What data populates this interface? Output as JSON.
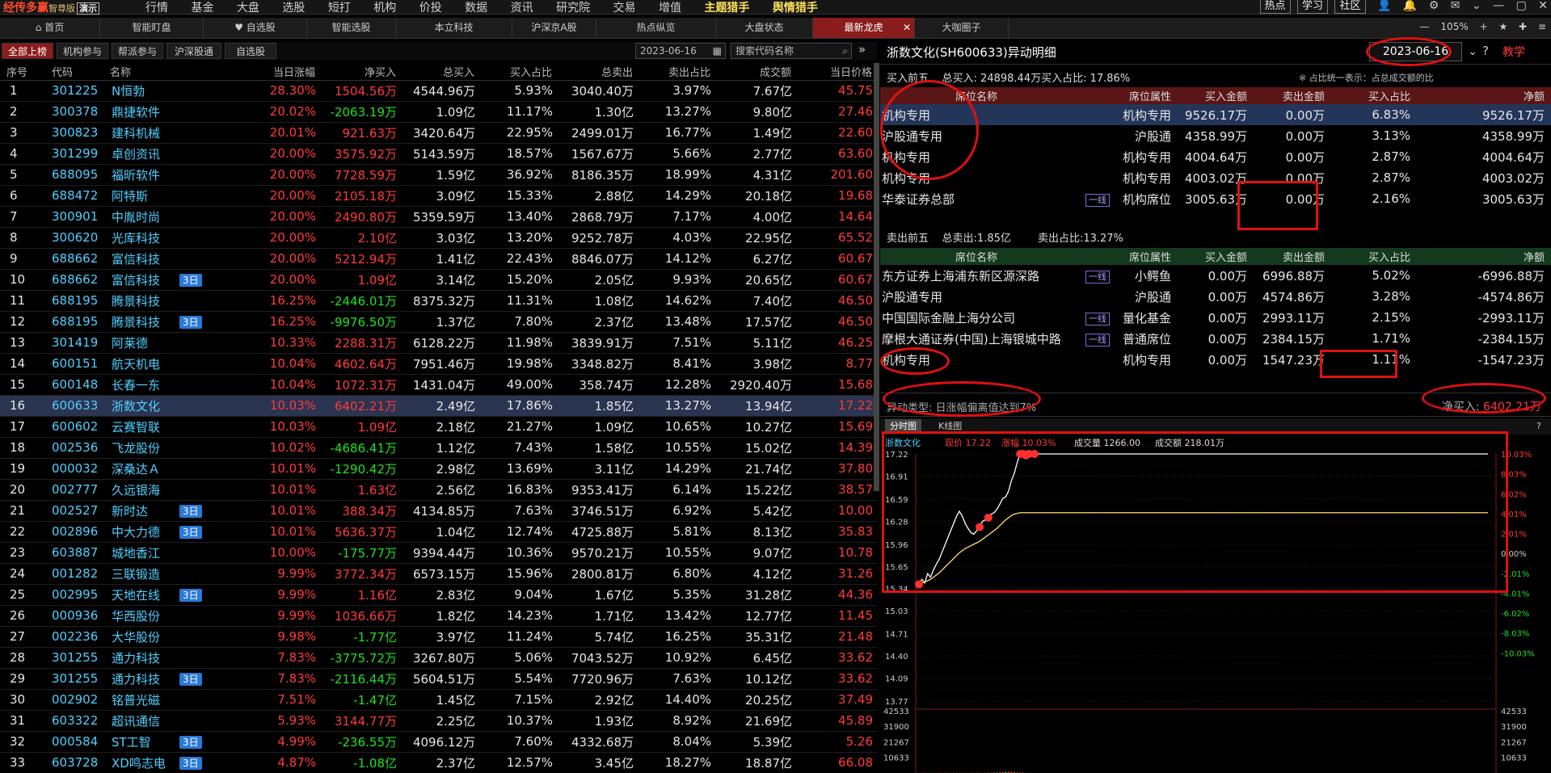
{
  "topbar": {
    "logo": "经传多赢",
    "edition": "智尊版",
    "demo": "演示",
    "menu": [
      "行情",
      "基金",
      "大盘",
      "选股",
      "短打",
      "机构",
      "价投",
      "数据",
      "资讯",
      "研究院",
      "交易",
      "增值",
      "主题猎手",
      "舆情猎手"
    ],
    "buttons": [
      "热点",
      "学习",
      "社区"
    ]
  },
  "tabs": [
    "首页",
    "智能盯盘",
    "自选股",
    "智能选股",
    "本立科技",
    "沪深京A股",
    "热点纵览",
    "大盘状态",
    "最新龙虎",
    "大咖圈子"
  ],
  "tab_right": {
    "zoom": "105%"
  },
  "filters": [
    "全部上榜",
    "机构参与",
    "帮派参与",
    "沪深股通",
    "自选股"
  ],
  "filter_date": "2023-06-16",
  "search_placeholder": "搜索代码名称",
  "list": {
    "headers": [
      "序号",
      "代码",
      "名称",
      "",
      "当日涨幅",
      "净买入",
      "总买入",
      "买入占比",
      "总卖出",
      "卖出占比",
      "成交额",
      "当日价格"
    ],
    "rows": [
      [
        "1",
        "301225",
        "N恒勃",
        "",
        "28.30%",
        "1504.56万",
        "4544.96万",
        "5.93%",
        "3040.40万",
        "3.97%",
        "7.67亿",
        "45.75"
      ],
      [
        "2",
        "300378",
        "鼎捷软件",
        "",
        "20.02%",
        "-2063.19万",
        "1.09亿",
        "11.17%",
        "1.30亿",
        "13.27%",
        "9.80亿",
        "27.46"
      ],
      [
        "3",
        "300823",
        "建科机械",
        "",
        "20.01%",
        "921.63万",
        "3420.64万",
        "22.95%",
        "2499.01万",
        "16.77%",
        "1.49亿",
        "22.60"
      ],
      [
        "4",
        "301299",
        "卓创资讯",
        "",
        "20.00%",
        "3575.92万",
        "5143.59万",
        "18.57%",
        "1567.67万",
        "5.66%",
        "2.77亿",
        "63.60"
      ],
      [
        "5",
        "688095",
        "福昕软件",
        "",
        "20.00%",
        "7728.59万",
        "1.59亿",
        "36.92%",
        "8186.35万",
        "18.99%",
        "4.31亿",
        "201.60"
      ],
      [
        "6",
        "688472",
        "阿特斯",
        "",
        "20.00%",
        "2105.18万",
        "3.09亿",
        "15.33%",
        "2.88亿",
        "14.29%",
        "20.18亿",
        "19.68"
      ],
      [
        "7",
        "300901",
        "中胤时尚",
        "",
        "20.00%",
        "2490.80万",
        "5359.59万",
        "13.40%",
        "2868.79万",
        "7.17%",
        "4.00亿",
        "14.64"
      ],
      [
        "8",
        "300620",
        "光库科技",
        "",
        "20.00%",
        "2.10亿",
        "3.03亿",
        "13.20%",
        "9252.78万",
        "4.03%",
        "22.95亿",
        "65.52"
      ],
      [
        "9",
        "688662",
        "富信科技",
        "",
        "20.00%",
        "5212.94万",
        "1.41亿",
        "22.43%",
        "8846.07万",
        "14.12%",
        "6.27亿",
        "60.67"
      ],
      [
        "10",
        "688662",
        "富信科技",
        "3日",
        "20.00%",
        "1.09亿",
        "3.14亿",
        "15.20%",
        "2.05亿",
        "9.93%",
        "20.65亿",
        "60.67"
      ],
      [
        "11",
        "688195",
        "腾景科技",
        "",
        "16.25%",
        "-2446.01万",
        "8375.32万",
        "11.31%",
        "1.08亿",
        "14.62%",
        "7.40亿",
        "46.50"
      ],
      [
        "12",
        "688195",
        "腾景科技",
        "3日",
        "16.25%",
        "-9976.50万",
        "1.37亿",
        "7.80%",
        "2.37亿",
        "13.48%",
        "17.57亿",
        "46.50"
      ],
      [
        "13",
        "301419",
        "阿莱德",
        "",
        "10.33%",
        "2288.31万",
        "6128.22万",
        "11.98%",
        "3839.91万",
        "7.51%",
        "5.11亿",
        "46.25"
      ],
      [
        "14",
        "600151",
        "航天机电",
        "",
        "10.04%",
        "4602.64万",
        "7951.46万",
        "19.98%",
        "3348.82万",
        "8.41%",
        "3.98亿",
        "8.77"
      ],
      [
        "15",
        "600148",
        "长春一东",
        "",
        "10.04%",
        "1072.31万",
        "1431.04万",
        "49.00%",
        "358.74万",
        "12.28%",
        "2920.40万",
        "15.68"
      ],
      [
        "16",
        "600633",
        "浙数文化",
        "",
        "10.03%",
        "6402.21万",
        "2.49亿",
        "17.86%",
        "1.85亿",
        "13.27%",
        "13.94亿",
        "17.22"
      ],
      [
        "17",
        "600602",
        "云赛智联",
        "",
        "10.03%",
        "1.09亿",
        "2.18亿",
        "21.27%",
        "1.09亿",
        "10.65%",
        "10.27亿",
        "15.69"
      ],
      [
        "18",
        "002536",
        "飞龙股份",
        "",
        "10.02%",
        "-4686.41万",
        "1.12亿",
        "7.43%",
        "1.58亿",
        "10.55%",
        "15.02亿",
        "14.39"
      ],
      [
        "19",
        "000032",
        "深桑达Ａ",
        "",
        "10.01%",
        "-1290.42万",
        "2.98亿",
        "13.69%",
        "3.11亿",
        "14.29%",
        "21.74亿",
        "37.80"
      ],
      [
        "20",
        "002777",
        "久远银海",
        "",
        "10.01%",
        "1.63亿",
        "2.56亿",
        "16.83%",
        "9353.41万",
        "6.14%",
        "15.22亿",
        "38.57"
      ],
      [
        "21",
        "002527",
        "新时达",
        "3日",
        "10.01%",
        "388.34万",
        "4134.85万",
        "7.63%",
        "3746.51万",
        "6.92%",
        "5.42亿",
        "10.00"
      ],
      [
        "22",
        "002896",
        "中大力德",
        "3日",
        "10.01%",
        "5636.37万",
        "1.04亿",
        "12.74%",
        "4725.88万",
        "5.81%",
        "8.13亿",
        "35.83"
      ],
      [
        "23",
        "603887",
        "城地香江",
        "",
        "10.00%",
        "-175.77万",
        "9394.44万",
        "10.36%",
        "9570.21万",
        "10.55%",
        "9.07亿",
        "10.78"
      ],
      [
        "24",
        "001282",
        "三联锻造",
        "",
        "9.99%",
        "3772.34万",
        "6573.15万",
        "15.96%",
        "2800.81万",
        "6.80%",
        "4.12亿",
        "31.26"
      ],
      [
        "25",
        "002995",
        "天地在线",
        "3日",
        "9.99%",
        "1.16亿",
        "2.83亿",
        "9.04%",
        "1.67亿",
        "5.35%",
        "31.28亿",
        "44.36"
      ],
      [
        "26",
        "000936",
        "华西股份",
        "",
        "9.99%",
        "1036.66万",
        "1.82亿",
        "14.23%",
        "1.71亿",
        "13.42%",
        "12.77亿",
        "11.45"
      ],
      [
        "27",
        "002236",
        "大华股份",
        "",
        "9.98%",
        "-1.77亿",
        "3.97亿",
        "11.24%",
        "5.74亿",
        "16.25%",
        "35.31亿",
        "21.48"
      ],
      [
        "28",
        "301255",
        "通力科技",
        "",
        "7.83%",
        "-3775.72万",
        "3267.80万",
        "5.06%",
        "7043.52万",
        "10.92%",
        "6.45亿",
        "33.62"
      ],
      [
        "29",
        "301255",
        "通力科技",
        "3日",
        "7.83%",
        "-2116.44万",
        "5604.51万",
        "5.54%",
        "7720.96万",
        "7.63%",
        "10.12亿",
        "33.62"
      ],
      [
        "30",
        "002902",
        "铭普光磁",
        "",
        "7.51%",
        "-1.47亿",
        "1.45亿",
        "7.15%",
        "2.92亿",
        "14.40%",
        "20.25亿",
        "37.49"
      ],
      [
        "31",
        "603322",
        "超讯通信",
        "",
        "5.93%",
        "3144.77万",
        "2.25亿",
        "10.37%",
        "1.93亿",
        "8.92%",
        "21.69亿",
        "45.89"
      ],
      [
        "32",
        "000584",
        "ST工智",
        "3日",
        "4.99%",
        "-236.55万",
        "4096.12万",
        "7.60%",
        "4332.68万",
        "8.04%",
        "5.39亿",
        "5.26"
      ],
      [
        "33",
        "603728",
        "XD鸣志电",
        "3日",
        "4.87%",
        "-1.08亿",
        "2.37亿",
        "12.57%",
        "3.45亿",
        "18.27%",
        "18.87亿",
        "66.08"
      ]
    ]
  },
  "detail": {
    "title": "浙数文化(SH600633)异动明细",
    "date": "2023-06-16",
    "teach": "教学",
    "buy_summary": {
      "label": "买入前五",
      "total": "总买入: 24898.44万",
      "ratio": "买入占比: 17.86%",
      "note": "※ 占比统一表示：占总成交额的比"
    },
    "sell_summary": {
      "label": "卖出前五",
      "total": "总卖出:1.85亿",
      "ratio": "卖出占比:13.27%"
    },
    "headers": [
      "席位名称",
      "",
      "席位属性",
      "买入金额",
      "卖出金额",
      "买入占比",
      "净额"
    ],
    "yx": "一线",
    "buy_rows": [
      [
        "机构专用",
        "",
        "机构专用",
        "9526.17万",
        "0.00万",
        "6.83%",
        "9526.17万"
      ],
      [
        "沪股通专用",
        "",
        "沪股通",
        "4358.99万",
        "0.00万",
        "3.13%",
        "4358.99万"
      ],
      [
        "机构专用",
        "",
        "机构专用",
        "4004.64万",
        "0.00万",
        "2.87%",
        "4004.64万"
      ],
      [
        "机构专用",
        "",
        "机构专用",
        "4003.02万",
        "0.00万",
        "2.87%",
        "4003.02万"
      ],
      [
        "华泰证券总部",
        "一线",
        "机构席位",
        "3005.63万",
        "0.00万",
        "2.16%",
        "3005.63万"
      ]
    ],
    "sell_rows": [
      [
        "东方证券上海浦东新区源深路",
        "一线",
        "小鳄鱼",
        "0.00万",
        "6996.88万",
        "5.02%",
        "-6996.88万"
      ],
      [
        "沪股通专用",
        "",
        "沪股通",
        "0.00万",
        "4574.86万",
        "3.28%",
        "-4574.86万"
      ],
      [
        "中国国际金融上海分公司",
        "一线",
        "量化基金",
        "0.00万",
        "2993.11万",
        "2.15%",
        "-2993.11万"
      ],
      [
        "摩根大通证券(中国)上海银城中路",
        "一线",
        "普通席位",
        "0.00万",
        "2384.15万",
        "1.71%",
        "-2384.15万"
      ],
      [
        "机构专用",
        "",
        "机构专用",
        "0.00万",
        "1547.23万",
        "1.11%",
        "-1547.23万"
      ]
    ],
    "anomaly": "异动类型: 日涨幅偏离值达到7%",
    "net_label": "净买入:",
    "net_value": "6402.21万"
  },
  "chart_data": {
    "type": "line",
    "tabs": [
      "分时图",
      "K线图"
    ],
    "info": {
      "name": "浙数文化",
      "price_label": "现价",
      "price": "17.22",
      "chg_label": "涨幅",
      "chg": "10.03%",
      "vol_label": "成交量",
      "vol": "1266.00",
      "amt_label": "成交额",
      "amt": "218.01万"
    },
    "price_ticks": [
      "17.22",
      "16.91",
      "16.59",
      "16.28",
      "15.96",
      "15.65",
      "15.34",
      "15.03",
      "14.71",
      "14.40",
      "14.09",
      "13.77"
    ],
    "pct_ticks": [
      "10.03%",
      "8.03%",
      "6.02%",
      "4.01%",
      "2.01%",
      "0.00%",
      "-2.01%",
      "-4.01%",
      "-6.02%",
      "-8.03%",
      "-10.03%"
    ],
    "vol_ticks": [
      "42533",
      "31900",
      "21267",
      "10633"
    ],
    "ylim": [
      13.77,
      17.22
    ],
    "price": [
      15.4,
      15.47,
      15.42,
      15.55,
      15.5,
      15.6,
      15.68,
      15.75,
      15.85,
      15.95,
      16.05,
      16.15,
      16.25,
      16.35,
      16.42,
      16.35,
      16.25,
      16.18,
      16.12,
      16.1,
      16.15,
      16.2,
      16.28,
      16.3,
      16.33,
      16.38,
      16.4,
      16.45,
      16.52,
      16.6,
      16.62,
      16.7,
      16.85,
      16.95,
      17.1,
      17.22,
      17.22,
      17.2,
      17.22,
      17.21,
      17.22,
      17.22,
      17.22,
      17.22,
      17.22,
      17.22,
      17.22,
      17.22,
      17.22,
      17.22,
      17.22,
      17.22,
      17.22,
      17.22,
      17.22,
      17.22,
      17.22,
      17.22,
      17.22,
      17.22,
      17.22,
      17.22,
      17.22
    ],
    "avg": [
      15.4,
      15.42,
      15.43,
      15.45,
      15.47,
      15.5,
      15.53,
      15.56,
      15.6,
      15.64,
      15.68,
      15.72,
      15.76,
      15.8,
      15.84,
      15.87,
      15.9,
      15.92,
      15.94,
      15.96,
      15.98,
      16.0,
      16.03,
      16.06,
      16.09,
      16.12,
      16.15,
      16.18,
      16.22,
      16.26,
      16.3,
      16.33,
      16.36,
      16.38,
      16.39,
      16.4,
      16.4,
      16.4,
      16.4,
      16.4,
      16.4,
      16.4,
      16.4,
      16.4,
      16.4,
      16.4,
      16.4,
      16.4,
      16.4,
      16.4,
      16.4,
      16.4,
      16.4,
      16.4,
      16.4,
      16.4,
      16.4,
      16.4,
      16.4,
      16.4,
      16.4,
      16.4,
      16.4
    ],
    "markers": [
      0,
      21,
      24,
      35,
      36,
      37,
      38,
      40
    ],
    "volume": [
      4,
      6,
      5,
      3,
      4,
      5,
      6,
      7,
      6,
      8,
      9,
      7,
      6,
      8,
      7,
      6,
      5,
      6,
      7,
      8,
      9,
      7,
      6,
      8,
      10,
      12,
      14,
      16,
      22,
      30,
      40,
      44,
      35,
      25,
      18,
      12,
      8,
      5,
      3,
      2,
      2,
      1,
      1,
      1,
      1,
      1,
      1,
      1,
      1,
      1,
      1,
      1,
      1,
      1,
      1,
      1,
      1,
      1,
      1,
      1,
      1,
      1,
      1
    ],
    "volmax": 42533
  }
}
